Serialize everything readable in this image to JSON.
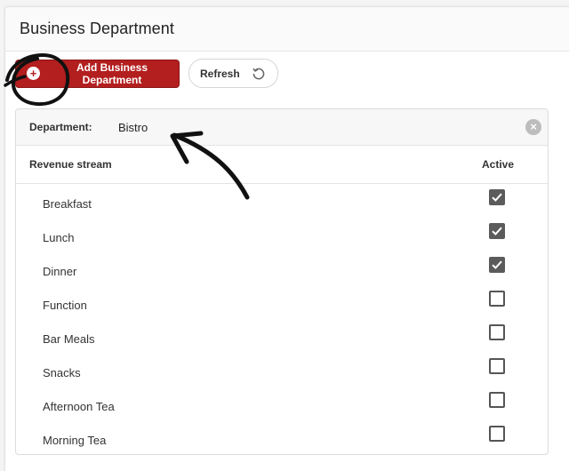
{
  "panel": {
    "title": "Business Department"
  },
  "toolbar": {
    "add_button_label": "Add Business Department",
    "refresh_button_label": "Refresh"
  },
  "department": {
    "label": "Department:",
    "value": "Bistro"
  },
  "table": {
    "headers": {
      "revenue_stream": "Revenue stream",
      "active": "Active"
    },
    "rows": [
      {
        "name": "Breakfast",
        "active": true
      },
      {
        "name": "Lunch",
        "active": true
      },
      {
        "name": "Dinner",
        "active": true
      },
      {
        "name": "Function",
        "active": false
      },
      {
        "name": "Bar Meals",
        "active": false
      },
      {
        "name": "Snacks",
        "active": false
      },
      {
        "name": "Afternoon Tea",
        "active": false
      },
      {
        "name": "Morning Tea",
        "active": false
      }
    ]
  },
  "colors": {
    "add_button": "#b31e1e",
    "checkbox_checked": "#5b5b5b",
    "annotation_ink": "#111111"
  },
  "icons": {
    "add": "plus-circle-icon",
    "refresh": "refresh-icon",
    "close": "close-icon",
    "check": "checkmark-icon"
  }
}
